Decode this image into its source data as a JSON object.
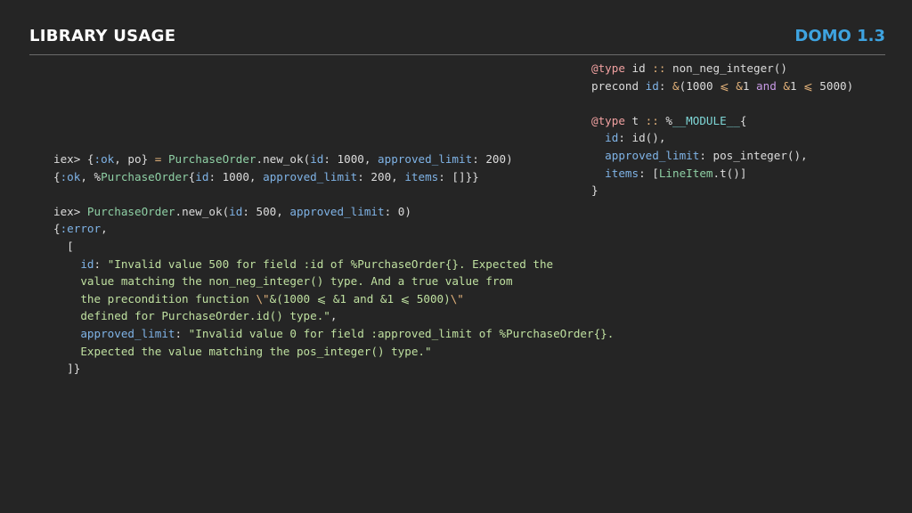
{
  "header": {
    "title": "LIBRARY USAGE",
    "version": "DOMO 1.3"
  },
  "colors": {
    "background": "#252525",
    "accent": "#3ea3e0",
    "title": "#ffffff",
    "rule": "#6a6a6a"
  },
  "code_right": {
    "lines": [
      [
        [
          "keyword",
          "@type"
        ],
        [
          "plain",
          " id "
        ],
        [
          "op",
          "::"
        ],
        [
          "plain",
          " non_neg_integer()"
        ]
      ],
      [
        [
          "plain",
          "precond "
        ],
        [
          "attr",
          "id"
        ],
        [
          "plain",
          ": "
        ],
        [
          "op",
          "&"
        ],
        [
          "plain",
          "(1000 "
        ],
        [
          "op",
          "⩽"
        ],
        [
          "plain",
          " "
        ],
        [
          "op",
          "&"
        ],
        [
          "plain",
          "1 "
        ],
        [
          "and",
          "and"
        ],
        [
          "plain",
          " "
        ],
        [
          "op",
          "&"
        ],
        [
          "plain",
          "1 "
        ],
        [
          "op",
          "⩽"
        ],
        [
          "plain",
          " 5000)"
        ]
      ],
      [],
      [
        [
          "keyword",
          "@type"
        ],
        [
          "plain",
          " t "
        ],
        [
          "op",
          "::"
        ],
        [
          "plain",
          " %"
        ],
        [
          "module",
          "__MODULE__"
        ],
        [
          "plain",
          "{"
        ]
      ],
      [
        [
          "plain",
          "  "
        ],
        [
          "attr",
          "id"
        ],
        [
          "plain",
          ": id(),"
        ]
      ],
      [
        [
          "plain",
          "  "
        ],
        [
          "attr",
          "approved_limit"
        ],
        [
          "plain",
          ": pos_integer(),"
        ]
      ],
      [
        [
          "plain",
          "  "
        ],
        [
          "attr",
          "items"
        ],
        [
          "plain",
          ": ["
        ],
        [
          "type",
          "LineItem"
        ],
        [
          "plain",
          ".t()]"
        ]
      ],
      [
        [
          "plain",
          "}"
        ]
      ]
    ]
  },
  "code_left": {
    "lines": [
      [
        [
          "plain",
          "iex> {"
        ],
        [
          "attr",
          ":ok"
        ],
        [
          "plain",
          ", po} "
        ],
        [
          "op",
          "="
        ],
        [
          "plain",
          " "
        ],
        [
          "type",
          "PurchaseOrder"
        ],
        [
          "plain",
          ".new_ok("
        ],
        [
          "attr",
          "id"
        ],
        [
          "plain",
          ": 1000, "
        ],
        [
          "attr",
          "approved_limit"
        ],
        [
          "plain",
          ": 200)"
        ]
      ],
      [
        [
          "plain",
          "{"
        ],
        [
          "attr",
          ":ok"
        ],
        [
          "plain",
          ", %"
        ],
        [
          "type",
          "PurchaseOrder"
        ],
        [
          "plain",
          "{"
        ],
        [
          "attr",
          "id"
        ],
        [
          "plain",
          ": 1000, "
        ],
        [
          "attr",
          "approved_limit"
        ],
        [
          "plain",
          ": 200, "
        ],
        [
          "attr",
          "items"
        ],
        [
          "plain",
          ": []}}"
        ]
      ],
      [],
      [
        [
          "plain",
          "iex> "
        ],
        [
          "type",
          "PurchaseOrder"
        ],
        [
          "plain",
          ".new_ok("
        ],
        [
          "attr",
          "id"
        ],
        [
          "plain",
          ": 500, "
        ],
        [
          "attr",
          "approved_limit"
        ],
        [
          "plain",
          ": 0)"
        ]
      ],
      [
        [
          "plain",
          "{"
        ],
        [
          "attr",
          ":error"
        ],
        [
          "plain",
          ","
        ]
      ],
      [
        [
          "plain",
          "  ["
        ]
      ],
      [
        [
          "plain",
          "    "
        ],
        [
          "attr",
          "id"
        ],
        [
          "plain",
          ": "
        ],
        [
          "string",
          "\"Invalid value 500 for field :id of %PurchaseOrder{}. Expected the"
        ]
      ],
      [
        [
          "string",
          "    value matching the non_neg_integer() type. And a true value from"
        ]
      ],
      [
        [
          "string",
          "    the precondition function "
        ],
        [
          "op",
          "\\\""
        ],
        [
          "string",
          "&(1000 ⩽ &1 and &1 ⩽ 5000)"
        ],
        [
          "op",
          "\\\""
        ]
      ],
      [
        [
          "string",
          "    defined for PurchaseOrder.id() type.\""
        ],
        [
          "plain",
          ","
        ]
      ],
      [
        [
          "plain",
          "    "
        ],
        [
          "attr",
          "approved_limit"
        ],
        [
          "plain",
          ": "
        ],
        [
          "string",
          "\"Invalid value 0 for field :approved_limit of %PurchaseOrder{}."
        ]
      ],
      [
        [
          "string",
          "    Expected the value matching the pos_integer() type.\""
        ]
      ],
      [
        [
          "plain",
          "  ]}"
        ]
      ]
    ]
  }
}
